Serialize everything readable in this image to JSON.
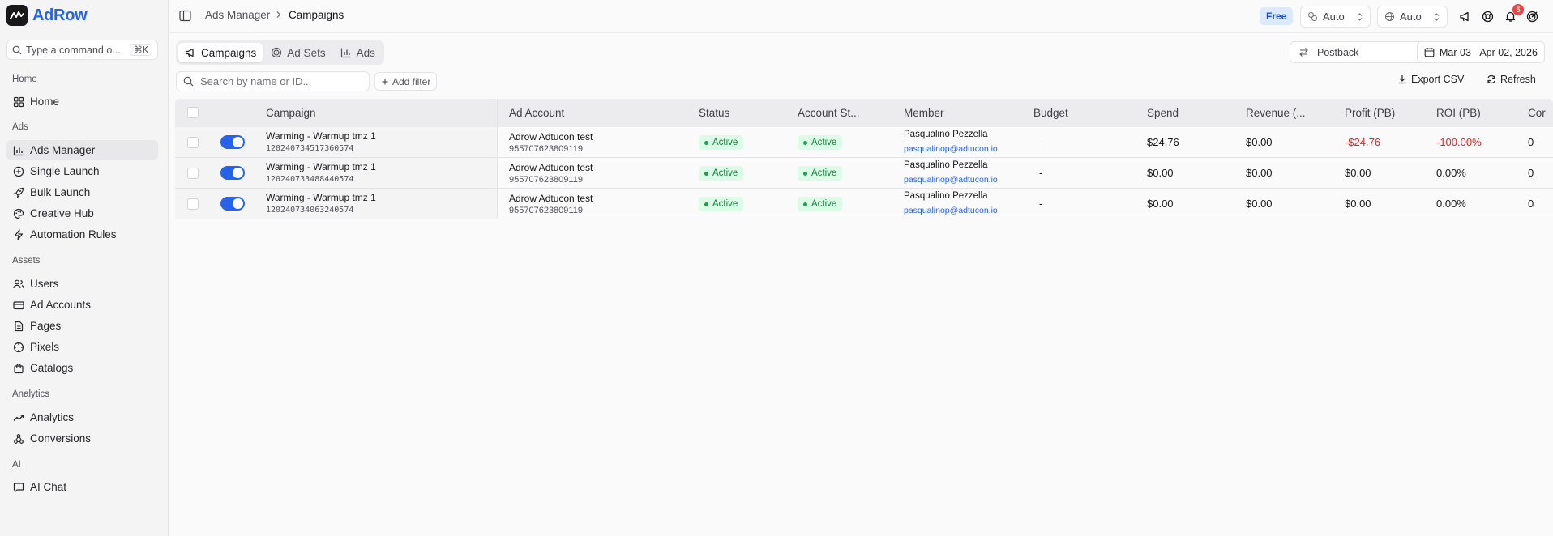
{
  "app": {
    "brand": "AdRow"
  },
  "sidebar": {
    "command_placeholder": "Type a command o...",
    "command_shortcut": "⌘K",
    "sections": [
      "Home",
      "Ads",
      "Assets",
      "Analytics",
      "AI"
    ],
    "items": {
      "home": "Home",
      "ads_manager": "Ads Manager",
      "single_launch": "Single Launch",
      "bulk_launch": "Bulk Launch",
      "creative_hub": "Creative Hub",
      "automation_rules": "Automation Rules",
      "users": "Users",
      "ad_accounts": "Ad Accounts",
      "pages": "Pages",
      "pixels": "Pixels",
      "catalogs": "Catalogs",
      "analytics": "Analytics",
      "conversions": "Conversions",
      "ai_chat": "AI Chat"
    }
  },
  "header": {
    "breadcrumb_parent": "Ads Manager",
    "breadcrumb_current": "Campaigns",
    "plan_badge": "Free",
    "select_1": "Auto",
    "select_2": "Auto",
    "notification_count": "5"
  },
  "tabs": {
    "campaigns": "Campaigns",
    "ad_sets": "Ad Sets",
    "ads": "Ads"
  },
  "toolbar": {
    "attribution": "Postback",
    "date_range": "Mar 03 - Apr 02, 2026",
    "search_placeholder": "Search by name or ID...",
    "add_filter": "Add filter",
    "export_csv": "Export CSV",
    "refresh": "Refresh"
  },
  "table": {
    "columns": {
      "campaign": "Campaign",
      "ad_account": "Ad Account",
      "status": "Status",
      "account_status": "Account St...",
      "member": "Member",
      "budget": "Budget",
      "spend": "Spend",
      "revenue": "Revenue (...",
      "profit": "Profit (PB)",
      "roi": "ROI (PB)",
      "conv": "Cor"
    },
    "rows": [
      {
        "name": "Warming - Warmup tmz 1",
        "id": "120240734517360574",
        "account": "Adrow Adtucon test",
        "account_id": "955707623809119",
        "status": "Active",
        "account_status": "Active",
        "member": "Pasqualino Pezzella",
        "email": "pasqualinop@adtucon.io",
        "budget": "-",
        "spend": "$24.76",
        "revenue": "$0.00",
        "profit": "-$24.76",
        "roi": "-100.00%",
        "conv": "0"
      },
      {
        "name": "Warming - Warmup tmz 1",
        "id": "120240733488440574",
        "account": "Adrow Adtucon test",
        "account_id": "955707623809119",
        "status": "Active",
        "account_status": "Active",
        "member": "Pasqualino Pezzella",
        "email": "pasqualinop@adtucon.io",
        "budget": "-",
        "spend": "$0.00",
        "revenue": "$0.00",
        "profit": "$0.00",
        "roi": "0.00%",
        "conv": "0"
      },
      {
        "name": "Warming - Warmup tmz 1",
        "id": "120240734063240574",
        "account": "Adrow Adtucon test",
        "account_id": "955707623809119",
        "status": "Active",
        "account_status": "Active",
        "member": "Pasqualino Pezzella",
        "email": "pasqualinop@adtucon.io",
        "budget": "-",
        "spend": "$0.00",
        "revenue": "$0.00",
        "profit": "$0.00",
        "roi": "0.00%",
        "conv": "0"
      }
    ]
  }
}
